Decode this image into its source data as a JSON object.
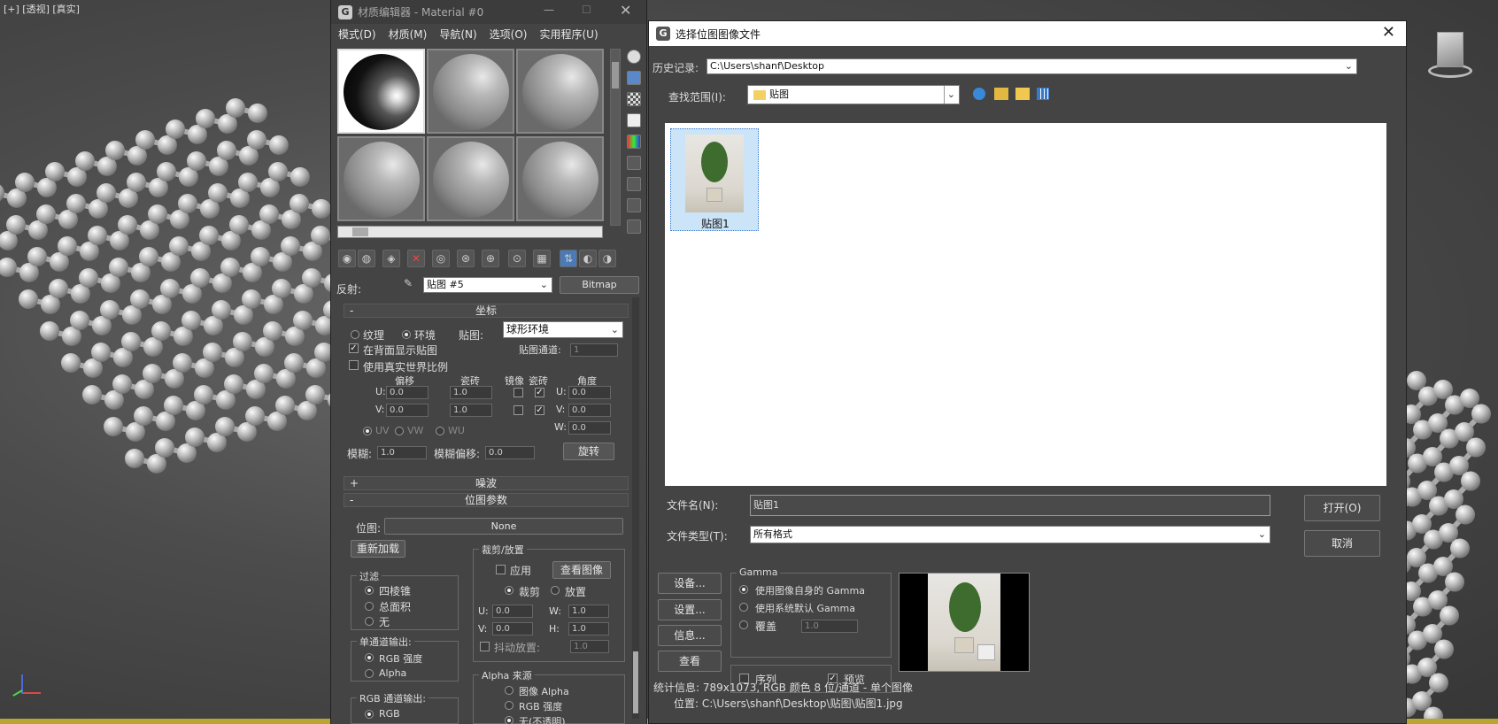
{
  "viewport": {
    "label": "[+] [透视] [真实]"
  },
  "material_editor": {
    "title": "材质编辑器 - Material #0",
    "menu": [
      "模式(D)",
      "材质(M)",
      "导航(N)",
      "选项(O)",
      "实用程序(U)"
    ],
    "reflection_label": "反射:",
    "map_name": "贴图 #5",
    "map_type": "Bitmap",
    "coords": {
      "header": "坐标",
      "texture": "纹理",
      "environ": "环境",
      "mapping_label": "贴图:",
      "mapping_value": "球形环境",
      "show_map_back": "在背面显示贴图",
      "map_channel_label": "贴图通道:",
      "map_channel_value": "1",
      "real_world": "使用真实世界比例",
      "offset": "偏移",
      "tiling": "瓷砖",
      "mirror": "镜像",
      "tile": "瓷砖",
      "angle": "角度",
      "u": "U:",
      "v": "V:",
      "w": "W:",
      "u_offset": "0.0",
      "v_offset": "0.0",
      "u_tiling": "1.0",
      "v_tiling": "1.0",
      "u_angle": "0.0",
      "v_angle": "0.0",
      "w_angle": "0.0",
      "uv": "UV",
      "vw": "VW",
      "wu": "WU",
      "blur_label": "模糊:",
      "blur_value": "1.0",
      "blur_offset_label": "模糊偏移:",
      "blur_offset_value": "0.0",
      "rotate": "旋转"
    },
    "noise": {
      "header": "噪波"
    },
    "bitmap_params": {
      "header": "位图参数",
      "bitmap_label": "位图:",
      "bitmap_value": "None",
      "reload": "重新加载",
      "crop_group": "裁剪/放置",
      "apply": "应用",
      "view_image": "查看图像",
      "crop": "裁剪",
      "place": "放置",
      "u_label": "U:",
      "v_label": "V:",
      "w_label": "W:",
      "h_label": "H:",
      "u_value": "0.0",
      "v_value": "0.0",
      "w_value": "1.0",
      "h_value": "1.0",
      "jitter": "抖动放置:",
      "jitter_value": "1.0",
      "filter_group": "过滤",
      "pyramidal": "四棱锥",
      "summed": "总面积",
      "none": "无",
      "mono_group": "单通道输出:",
      "rgb_intensity": "RGB 强度",
      "alpha": "Alpha",
      "rgb_out_group": "RGB 通道输出:",
      "rgb": "RGB",
      "alpha_source_group": "Alpha 来源",
      "image_alpha": "图像 Alpha",
      "rgb_intensity2": "RGB 强度",
      "none_opaque": "无(不透明)"
    }
  },
  "dialog": {
    "title": "选择位图图像文件",
    "history_label": "历史记录:",
    "history_value": "C:\\Users\\shanf\\Desktop",
    "lookin_label": "查找范围(I):",
    "lookin_value": "贴图",
    "file_items": [
      {
        "name": "贴图1"
      }
    ],
    "filename_label": "文件名(N):",
    "filename_value": "贴图1",
    "filetype_label": "文件类型(T):",
    "filetype_value": "所有格式",
    "open": "打开(O)",
    "cancel": "取消",
    "setup1": "设备...",
    "setup2": "设置...",
    "info": "信息...",
    "view": "查看",
    "gamma_group": "Gamma",
    "gamma_own": "使用图像自身的 Gamma",
    "gamma_system": "使用系统默认 Gamma",
    "gamma_override": "覆盖",
    "gamma_override_value": "1.0",
    "sequence": "序列",
    "preview": "预览",
    "stats": "统计信息: 789x1073, RGB 颜色 8 位/通道 - 单个图像",
    "location": "位置: C:\\Users\\shanf\\Desktop\\贴图\\贴图1.jpg"
  }
}
